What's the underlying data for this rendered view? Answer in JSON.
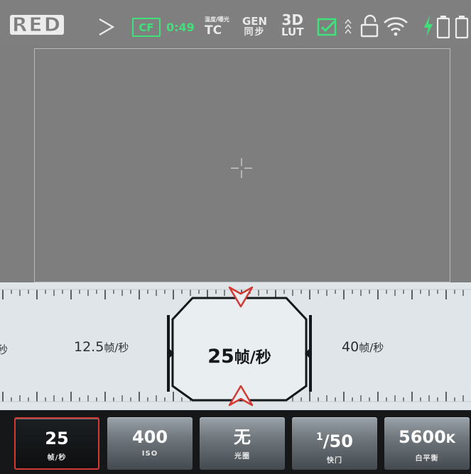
{
  "status_bar": {
    "brand": "RED",
    "media": {
      "label": "CF",
      "remaining": "0:49"
    },
    "timecode": {
      "mode_top": "温度/曝光",
      "mode_top_a": "温度",
      "mode_top_b": "曝光",
      "label": "TC"
    },
    "genlock": {
      "top": "GEN",
      "bottom": "同步"
    },
    "lut": {
      "top": "3D",
      "bottom": "LUT"
    },
    "icons": [
      "checkbox-icon",
      "chevrons-up-icon",
      "unlock-icon",
      "wifi-icon",
      "power-bolt-icon",
      "battery-icon",
      "battery-icon"
    ],
    "colors": {
      "accent_green": "#3fe27a",
      "bar_bg": "#7f7f7f"
    }
  },
  "dial": {
    "left_partial_label": "秒",
    "prev": {
      "value": "12.5",
      "unit": "帧/秒"
    },
    "current": {
      "value": "25",
      "unit": "帧/秒"
    },
    "next": {
      "value": "40",
      "unit": "帧/秒"
    },
    "colors": {
      "marker": "#d23a36",
      "bg": "#dfe5e8"
    }
  },
  "params": [
    {
      "id": "fps",
      "value": "25",
      "label": "帧/秒",
      "active": true
    },
    {
      "id": "iso",
      "value": "400",
      "label": "ISO",
      "active": false
    },
    {
      "id": "aperture",
      "value": "无",
      "label": "光圈",
      "active": false
    },
    {
      "id": "shutter",
      "value_sup": "1",
      "value_main": "/50",
      "label": "快门",
      "active": false
    },
    {
      "id": "white-balance",
      "value_main": "5600",
      "value_unit": "K",
      "label": "白平衡",
      "active": false
    }
  ]
}
